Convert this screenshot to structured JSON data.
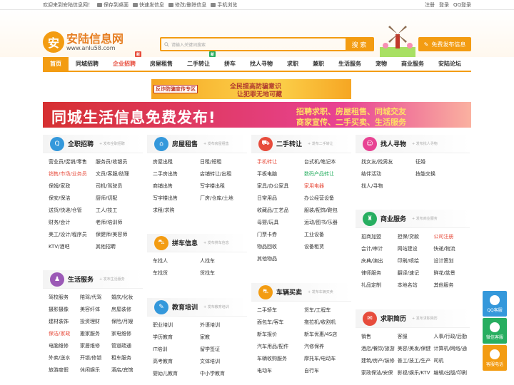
{
  "topbar": {
    "welcome": "欢迎来到安陆信息网！",
    "save_desktop": "保存到桌面",
    "quick_post": "快速发信息",
    "edit_delete": "修改/删除信息",
    "mobile": "手机浏览",
    "register": "注册",
    "login": "登录",
    "qq_login": "QQ登录"
  },
  "logo": {
    "cn": "安陆信息网",
    "en": "www.anlu58.com",
    "mark": "安"
  },
  "search": {
    "placeholder": "请输入关键词搜索",
    "button": "搜 索"
  },
  "publish_button": "免费发布信息",
  "nav": [
    {
      "label": "首页",
      "active": true
    },
    {
      "label": "同城招聘"
    },
    {
      "label": "企业招聘",
      "hot": true,
      "badge": "新",
      "badge_color": "#e74c3c"
    },
    {
      "label": "房屋租售"
    },
    {
      "label": "二手转让",
      "badge": "新",
      "badge_color": "#27ae60"
    },
    {
      "label": "拼车"
    },
    {
      "label": "找人寻物"
    },
    {
      "label": "求职"
    },
    {
      "label": "兼职"
    },
    {
      "label": "生活服务"
    },
    {
      "label": "宠物"
    },
    {
      "label": "商业服务"
    },
    {
      "label": "安陆论坛"
    }
  ],
  "banner1": {
    "tag": "反诈防骗宣传专区",
    "line1": "全民提高防骗意识",
    "line2": "让犯罪无地可藏"
  },
  "banner2": {
    "title": "同城生活信息免费发布!",
    "sub1": "招聘求职、房屋租售、同城交友",
    "sub2": "商家宣传、二手买卖、生活服务"
  },
  "categories": [
    {
      "id": "jobs",
      "title": "全职招聘",
      "more": "+ 发布全职招聘",
      "color": "#3498db",
      "glyph": "Q",
      "cols": 2,
      "items": [
        {
          "t": "营业员/促销/零售"
        },
        {
          "t": "服务员/收银员"
        },
        {
          "t": "销售/市场/业务员",
          "c": "red"
        },
        {
          "t": "文员/客服/助理"
        },
        {
          "t": "保姆/家政"
        },
        {
          "t": "司机/驾驶员"
        },
        {
          "t": "保安/保洁"
        },
        {
          "t": "厨师/切配"
        },
        {
          "t": "送货/快递/仓管"
        },
        {
          "t": "工人/技工"
        },
        {
          "t": "财务/会计"
        },
        {
          "t": "老师/培训师"
        },
        {
          "t": "美工/设计/程序员"
        },
        {
          "t": "保健师/美容师"
        },
        {
          "t": "KTV/酒吧"
        },
        {
          "t": "其他招聘"
        }
      ]
    },
    {
      "id": "house",
      "title": "房屋租售",
      "more": "+ 发布房屋租售",
      "color": "#3498db",
      "glyph": "⌂",
      "cols": 2,
      "items": [
        {
          "t": "房屋出租"
        },
        {
          "t": "日租/短租"
        },
        {
          "t": "二手房出售"
        },
        {
          "t": "店铺转让/出租"
        },
        {
          "t": "商铺出售"
        },
        {
          "t": "写字楼出租"
        },
        {
          "t": "写字楼出售"
        },
        {
          "t": "厂房/仓库/土地"
        },
        {
          "t": "求租/求购"
        }
      ]
    },
    {
      "id": "second",
      "title": "二手转让",
      "more": "+ 发布二手转让",
      "color": "#e74c3c",
      "glyph": "⛟",
      "cols": 2,
      "items": [
        {
          "t": "手机转让",
          "c": "red"
        },
        {
          "t": "台式机/笔记本"
        },
        {
          "t": "平板电脑"
        },
        {
          "t": "数码产品转让",
          "c": "green"
        },
        {
          "t": "家具/办公家具"
        },
        {
          "t": "家用电器",
          "c": "red"
        },
        {
          "t": "日常用品"
        },
        {
          "t": "办公经营设备"
        },
        {
          "t": "收藏品/工艺品"
        },
        {
          "t": "服装/配饰/鞋包"
        },
        {
          "t": "母婴/玩具"
        },
        {
          "t": "运动/图书/乐器"
        },
        {
          "t": "门票卡券"
        },
        {
          "t": "工业设备"
        },
        {
          "t": "物品回收"
        },
        {
          "t": "设备租赁"
        },
        {
          "t": "其他物品"
        }
      ]
    },
    {
      "id": "find",
      "title": "找人寻物",
      "more": "+ 发布找人寻物",
      "color": "#e84393",
      "glyph": "☺",
      "cols": 2,
      "items": [
        {
          "t": "找女友/找男友"
        },
        {
          "t": "征婚"
        },
        {
          "t": "结伴活动"
        },
        {
          "t": "技能交换"
        },
        {
          "t": "找人/寻物"
        }
      ]
    },
    {
      "id": "life",
      "title": "生活服务",
      "more": "+ 发布生活服务",
      "color": "#9b59b6",
      "glyph": "♟",
      "cols": 3,
      "items": [
        {
          "t": "驾校服务"
        },
        {
          "t": "陪驾/代驾"
        },
        {
          "t": "婚庆/化妆"
        },
        {
          "t": "摄影摄像"
        },
        {
          "t": "美容纤体"
        },
        {
          "t": "房屋装修"
        },
        {
          "t": "建材装饰"
        },
        {
          "t": "投资理财"
        },
        {
          "t": "保险/月嫂"
        },
        {
          "t": "保洁/家政",
          "c": "red"
        },
        {
          "t": "搬家服务"
        },
        {
          "t": "家电维修"
        },
        {
          "t": "电脑维修"
        },
        {
          "t": "家居维修"
        },
        {
          "t": "管道疏通"
        },
        {
          "t": "外卖/送水"
        },
        {
          "t": "开锁/修锁"
        },
        {
          "t": "租车服务"
        },
        {
          "t": "旅游度假"
        },
        {
          "t": "休闲娱乐"
        },
        {
          "t": "酒店/宾馆"
        }
      ]
    },
    {
      "id": "carpool",
      "title": "拼车信息",
      "more": "+ 发布拼车信息",
      "color": "#f39c12",
      "glyph": "⛍",
      "cols": 2,
      "items": [
        {
          "t": "车找人"
        },
        {
          "t": "人找车"
        },
        {
          "t": "车找货"
        },
        {
          "t": "货找车"
        }
      ]
    },
    {
      "id": "edu",
      "title": "教育培训",
      "more": "+ 发布教育培训",
      "color": "#3498db",
      "glyph": "✎",
      "cols": 2,
      "items": [
        {
          "t": "职业培训"
        },
        {
          "t": "外语培训"
        },
        {
          "t": "学历教育"
        },
        {
          "t": "家教"
        },
        {
          "t": "IT培训"
        },
        {
          "t": "留学签证"
        },
        {
          "t": "高考教育"
        },
        {
          "t": "文体培训"
        },
        {
          "t": "婴幼儿教育"
        },
        {
          "t": "中小学教育"
        }
      ]
    },
    {
      "id": "biz",
      "title": "商业服务",
      "more": "+ 发布商业服务",
      "color": "#27ae60",
      "glyph": "♜",
      "cols": 3,
      "items": [
        {
          "t": "招商加盟"
        },
        {
          "t": "担保/贷款"
        },
        {
          "t": "公司注册",
          "c": "red"
        },
        {
          "t": "会计/审计"
        },
        {
          "t": "网站建设"
        },
        {
          "t": "快递/物流"
        },
        {
          "t": "庆典/演出"
        },
        {
          "t": "印刷/喷绘"
        },
        {
          "t": "设计策划"
        },
        {
          "t": "律师服务"
        },
        {
          "t": "翻译/速记"
        },
        {
          "t": "鲜花/盆景"
        },
        {
          "t": "礼品定制"
        },
        {
          "t": "本地名站"
        },
        {
          "t": "其他服务"
        }
      ]
    },
    {
      "id": "car",
      "title": "车辆买卖",
      "more": "+ 发布车辆买卖",
      "color": "#f39c12",
      "glyph": "⛐",
      "cols": 2,
      "items": [
        {
          "t": "二手轿车"
        },
        {
          "t": "货车/工程车"
        },
        {
          "t": "面包车/客车"
        },
        {
          "t": "拖拉机/收割机"
        },
        {
          "t": "新车报价"
        },
        {
          "t": "新车优惠/4S店"
        },
        {
          "t": "汽车用品/配件"
        },
        {
          "t": "汽修保养"
        },
        {
          "t": "车辆收购服务"
        },
        {
          "t": "摩托车/电动车"
        },
        {
          "t": "电动车"
        },
        {
          "t": "自行车"
        }
      ]
    },
    {
      "id": "resume",
      "title": "求职简历",
      "more": "+ 发布求职简历",
      "color": "#e74c3c",
      "glyph": "✉",
      "cols": 3,
      "items": [
        {
          "t": "销售"
        },
        {
          "t": "客服"
        },
        {
          "t": "人事/行政/后勤"
        },
        {
          "t": "酒店/餐饮/旅游"
        },
        {
          "t": "美容/美发/保健"
        },
        {
          "t": "计算机/网络/通"
        },
        {
          "t": "建筑/房产/装修"
        },
        {
          "t": "普工/技工/生产"
        },
        {
          "t": "司机"
        },
        {
          "t": "家政保洁/安保"
        },
        {
          "t": "影视/娱乐/KTV"
        },
        {
          "t": "编辑/出版/印刷"
        }
      ]
    }
  ],
  "sidebar": [
    {
      "label": "QQ客服",
      "color": "#3498db"
    },
    {
      "label": "微信客服",
      "color": "#27ae60"
    },
    {
      "label": "客服电话",
      "color": "#f39c12"
    }
  ]
}
